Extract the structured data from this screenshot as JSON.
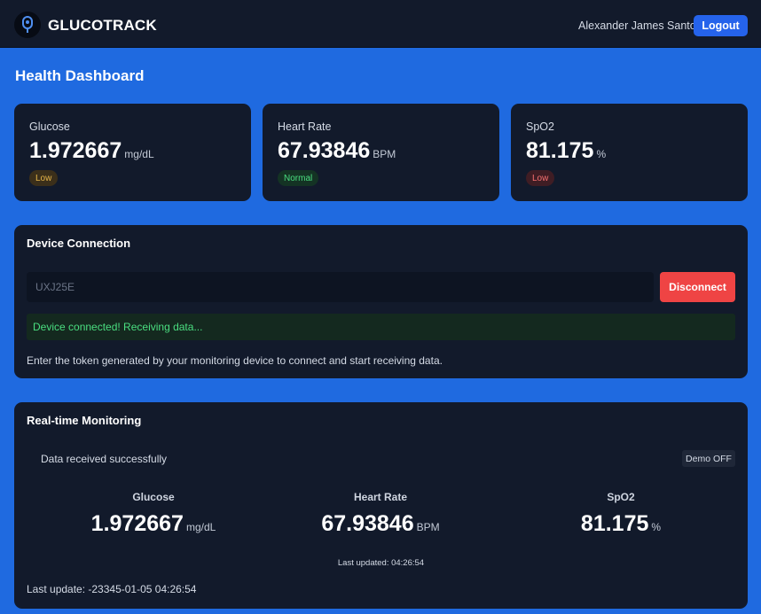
{
  "header": {
    "brand": "GLUCOTRACK",
    "user_name": "Alexander James Santos",
    "logout_label": "Logout"
  },
  "page_title": "Health Dashboard",
  "metrics": [
    {
      "label": "Glucose",
      "value": "1.972667",
      "unit": "mg/dL",
      "status": "Low"
    },
    {
      "label": "Heart Rate",
      "value": "67.93846",
      "unit": "BPM",
      "status": "Normal"
    },
    {
      "label": "SpO2",
      "value": "81.175",
      "unit": "%",
      "status": "Low"
    }
  ],
  "device": {
    "title": "Device Connection",
    "token_value": "UXJ25E",
    "disconnect_label": "Disconnect",
    "status_message": "Device connected! Receiving data...",
    "help_text": "Enter the token generated by your monitoring device to connect and start receiving data."
  },
  "monitoring": {
    "title": "Real-time Monitoring",
    "data_status": "Data received successfully",
    "demo_label": "Demo OFF",
    "readings": [
      {
        "label": "Glucose",
        "value": "1.972667",
        "unit": "mg/dL"
      },
      {
        "label": "Heart Rate",
        "value": "67.93846",
        "unit": "BPM"
      },
      {
        "label": "SpO2",
        "value": "81.175",
        "unit": "%"
      }
    ],
    "last_updated": "Last updated: 04:26:54",
    "last_update": "Last update: -23345-01-05 04:26:54"
  },
  "colors": {
    "background": "#1f6ae0",
    "card": "#121a2b",
    "accent": "#2563eb",
    "danger": "#ef4444",
    "success": "#4ade80"
  }
}
